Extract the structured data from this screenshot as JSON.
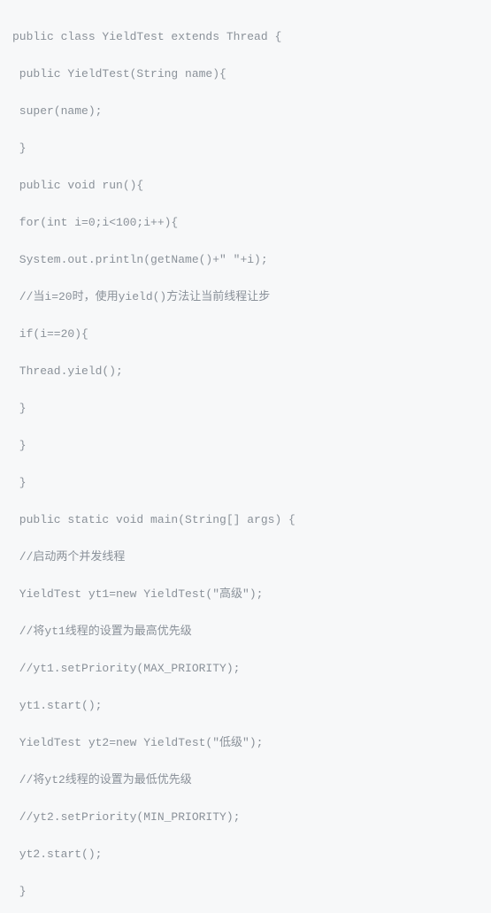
{
  "code": {
    "lines": [
      "public class YieldTest extends Thread {",
      " public YieldTest(String name){",
      " super(name);",
      " }",
      " public void run(){",
      " for(int i=0;i<100;i++){",
      " System.out.println(getName()+\" \"+i);",
      " //当i=20时，使用yield()方法让当前线程让步",
      " if(i==20){",
      " Thread.yield();",
      " }",
      " }",
      " }",
      " public static void main(String[] args) {",
      " //启动两个并发线程",
      " YieldTest yt1=new YieldTest(\"高级\");",
      " //将yt1线程的设置为最高优先级",
      " //yt1.setPriority(MAX_PRIORITY);",
      " yt1.start();",
      " YieldTest yt2=new YieldTest(\"低级\");",
      " //将yt2线程的设置为最低优先级",
      " //yt2.setPriority(MIN_PRIORITY);",
      " yt2.start();",
      " }"
    ]
  }
}
